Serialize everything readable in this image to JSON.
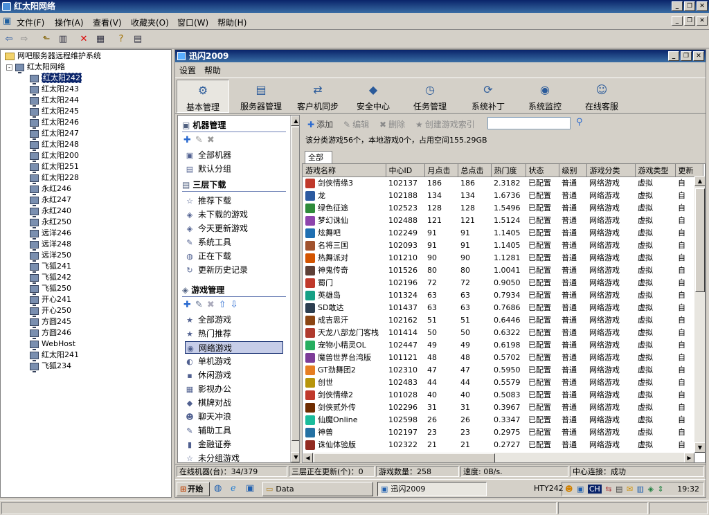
{
  "outer": {
    "title": "红太阳网络",
    "menu": [
      "文件(F)",
      "操作(A)",
      "查看(V)",
      "收藏夹(O)",
      "窗口(W)",
      "帮助(H)"
    ]
  },
  "tree": {
    "root": "网吧服务器远程维护系统",
    "group": "红太阳网络",
    "nodes": [
      "红太阳242",
      "红太阳243",
      "红太阳244",
      "红太阳245",
      "红太阳246",
      "红太阳247",
      "红太阳248",
      "红太阳200",
      "红太阳251",
      "红太阳228",
      "永红246",
      "永红247",
      "永红240",
      "永红250",
      "远洋246",
      "远洋248",
      "远洋250",
      "飞狐241",
      "飞狐242",
      "飞狐250",
      "开心241",
      "开心250",
      "方圆245",
      "方圆246",
      "WebHost",
      "红太阳241",
      "飞狐234"
    ],
    "selected_index": 0
  },
  "app": {
    "title": "迅闪2009",
    "menu": [
      "设置",
      "帮助"
    ],
    "nav": [
      {
        "label": "基本管理",
        "icon": "gear-icon",
        "glyph": "⚙"
      },
      {
        "label": "服务器管理",
        "icon": "server-icon",
        "glyph": "▤"
      },
      {
        "label": "客户机同步",
        "icon": "sync-icon",
        "glyph": "⇄"
      },
      {
        "label": "安全中心",
        "icon": "shield-icon",
        "glyph": "◆"
      },
      {
        "label": "任务管理",
        "icon": "task-icon",
        "glyph": "◷"
      },
      {
        "label": "系统补丁",
        "icon": "patch-icon",
        "glyph": "⟳"
      },
      {
        "label": "系统监控",
        "icon": "monitor-icon",
        "glyph": "◉"
      },
      {
        "label": "在线客服",
        "icon": "smiley-icon",
        "glyph": "☺"
      }
    ],
    "nav_active": 0
  },
  "side": {
    "machine_title": "机器管理",
    "machine_items": [
      "全部机器",
      "默认分组"
    ],
    "download_title": "三层下载",
    "download_items": [
      "推荐下载",
      "未下载的游戏",
      "今天更新游戏",
      "系统工具",
      "正在下载",
      "更新历史记录"
    ],
    "game_title": "游戏管理",
    "game_items": [
      "全部游戏",
      "热门推荐",
      "网络游戏",
      "单机游戏",
      "休闲游戏",
      "影视办公",
      "棋牌对战",
      "聊天冲浪",
      "辅助工具",
      "金融证券",
      "未分组游戏"
    ],
    "game_selected": 2
  },
  "games": {
    "toolbar": {
      "add": "添加",
      "edit": "编辑",
      "delete": "删除",
      "index": "创建游戏索引"
    },
    "info": "该分类游戏56个，本地游戏0个，占用空间155.29GB",
    "tab": "全部",
    "columns": [
      "游戏名称",
      "中心ID",
      "月点击",
      "总点击",
      "热门度",
      "状态",
      "级别",
      "游戏分类",
      "游戏类型",
      "更新"
    ],
    "rows": [
      [
        "剑侠情缘3",
        "102137",
        "186",
        "186",
        "2.3182",
        "已配置",
        "普通",
        "网络游戏",
        "虚拟",
        "自"
      ],
      [
        "龙",
        "102188",
        "134",
        "134",
        "1.6736",
        "已配置",
        "普通",
        "网络游戏",
        "虚拟",
        "自"
      ],
      [
        "绿色征途",
        "102523",
        "128",
        "128",
        "1.5496",
        "已配置",
        "普通",
        "网络游戏",
        "虚拟",
        "自"
      ],
      [
        "梦幻诛仙",
        "102488",
        "121",
        "121",
        "1.5124",
        "已配置",
        "普通",
        "网络游戏",
        "虚拟",
        "自"
      ],
      [
        "炫舞吧",
        "102249",
        "91",
        "91",
        "1.1405",
        "已配置",
        "普通",
        "网络游戏",
        "虚拟",
        "自"
      ],
      [
        "名将三国",
        "102093",
        "91",
        "91",
        "1.1405",
        "已配置",
        "普通",
        "网络游戏",
        "虚拟",
        "自"
      ],
      [
        "热舞派对",
        "101210",
        "90",
        "90",
        "1.1281",
        "已配置",
        "普通",
        "网络游戏",
        "虚拟",
        "自"
      ],
      [
        "神鬼传奇",
        "101526",
        "80",
        "80",
        "1.0041",
        "已配置",
        "普通",
        "网络游戏",
        "虚拟",
        "自"
      ],
      [
        "蜀门",
        "102196",
        "72",
        "72",
        "0.9050",
        "已配置",
        "普通",
        "网络游戏",
        "虚拟",
        "自"
      ],
      [
        "英雄岛",
        "101324",
        "63",
        "63",
        "0.7934",
        "已配置",
        "普通",
        "网络游戏",
        "虚拟",
        "自"
      ],
      [
        "SD敢达",
        "101437",
        "63",
        "63",
        "0.7686",
        "已配置",
        "普通",
        "网络游戏",
        "虚拟",
        "自"
      ],
      [
        "成吉思汗",
        "102162",
        "51",
        "51",
        "0.6446",
        "已配置",
        "普通",
        "网络游戏",
        "虚拟",
        "自"
      ],
      [
        "天龙八部龙门客栈",
        "101414",
        "50",
        "50",
        "0.6322",
        "已配置",
        "普通",
        "网络游戏",
        "虚拟",
        "自"
      ],
      [
        "宠物小精灵OL",
        "102447",
        "49",
        "49",
        "0.6198",
        "已配置",
        "普通",
        "网络游戏",
        "虚拟",
        "自"
      ],
      [
        "魔兽世界台湾版",
        "101121",
        "48",
        "48",
        "0.5702",
        "已配置",
        "普通",
        "网络游戏",
        "虚拟",
        "自"
      ],
      [
        "GT劲舞团2",
        "102310",
        "47",
        "47",
        "0.5950",
        "已配置",
        "普通",
        "网络游戏",
        "虚拟",
        "自"
      ],
      [
        "创世",
        "102483",
        "44",
        "44",
        "0.5579",
        "已配置",
        "普通",
        "网络游戏",
        "虚拟",
        "自"
      ],
      [
        "剑侠情缘2",
        "101028",
        "40",
        "40",
        "0.5083",
        "已配置",
        "普通",
        "网络游戏",
        "虚拟",
        "自"
      ],
      [
        "剑侠贰外传",
        "102296",
        "31",
        "31",
        "0.3967",
        "已配置",
        "普通",
        "网络游戏",
        "虚拟",
        "自"
      ],
      [
        "仙魔Online",
        "102598",
        "26",
        "26",
        "0.3347",
        "已配置",
        "普通",
        "网络游戏",
        "虚拟",
        "自"
      ],
      [
        "神兽",
        "102197",
        "23",
        "23",
        "0.2975",
        "已配置",
        "普通",
        "网络游戏",
        "虚拟",
        "自"
      ],
      [
        "诛仙体验版",
        "102322",
        "21",
        "21",
        "0.2727",
        "已配置",
        "普通",
        "网络游戏",
        "虚拟",
        "自"
      ]
    ],
    "icon_colors": [
      "#c0392b",
      "#2c5aa0",
      "#2e8b3a",
      "#8e44ad",
      "#1f6fb2",
      "#a0522d",
      "#d35400",
      "#5d4037",
      "#c0392b",
      "#16a085",
      "#2c3e50",
      "#8b4513",
      "#b03a2e",
      "#27ae60",
      "#7d3c98",
      "#e67e22",
      "#b7950b",
      "#c0392b",
      "#6e2c00",
      "#1abc9c",
      "#2471a3",
      "#922b21"
    ]
  },
  "status": {
    "online": "在线机器(台)：34/379",
    "updating": "三层正在更新(个)：0",
    "count": "游戏数量：258",
    "speed": "速度: 0B/s.",
    "center": "中心连接：成功"
  },
  "taskbar": {
    "start": "开始",
    "task1": "Data",
    "task2": "迅闪2009",
    "host": "HTY242",
    "lang": "CH",
    "time": "19:32"
  }
}
